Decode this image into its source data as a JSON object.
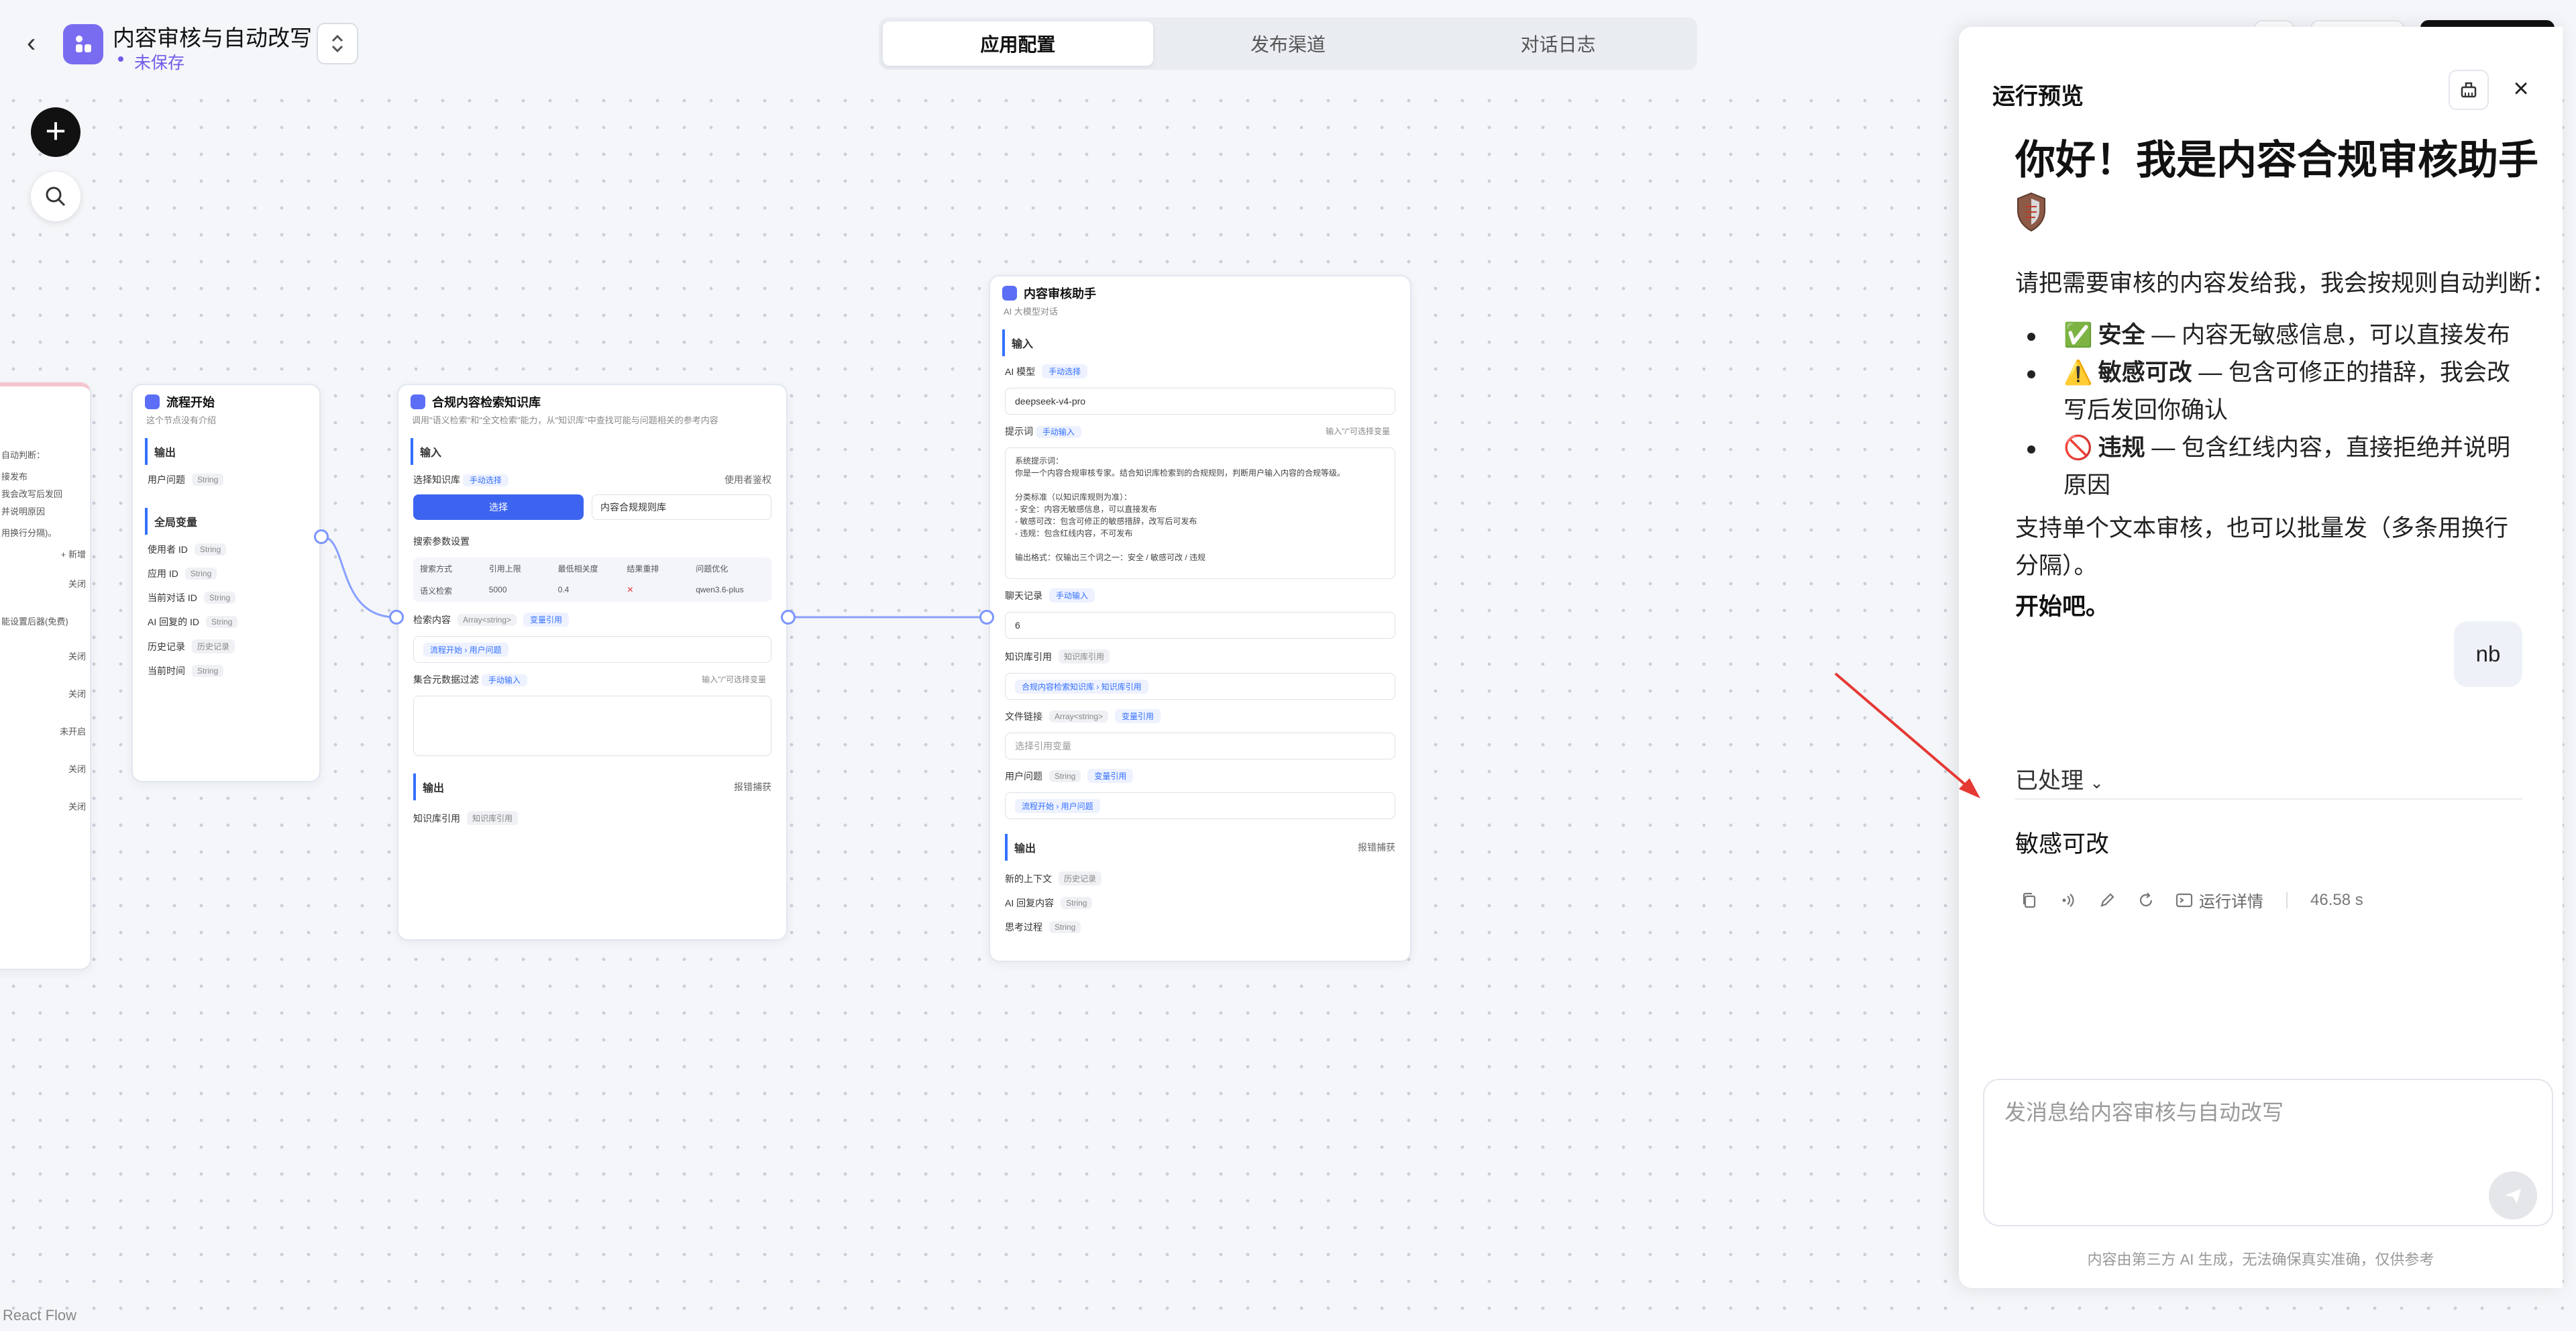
{
  "header": {
    "back_label": "‹",
    "app_title": "内容审核与自动改写",
    "save_status": "未保存",
    "tabs": [
      {
        "label": "应用配置",
        "active": true
      },
      {
        "label": "发布渠道",
        "active": false
      },
      {
        "label": "对话日志",
        "active": false
      }
    ]
  },
  "canvas": {
    "react_flow_label": "React Flow",
    "partial_node": {
      "lines": [
        "自动判断：",
        "接发布",
        "我会改写后发回",
        "并说明原因",
        "用换行分隔)。",
        "+ 新增",
        "关闭",
        "能设置后器(免费)",
        "关闭",
        "关闭",
        "未开启",
        "关闭",
        "关闭"
      ]
    },
    "start_node": {
      "title": "流程开始",
      "subtitle": "这个节点没有介绍",
      "output_title": "输出",
      "output_field": "用户问题",
      "output_type": "String",
      "globals_title": "全局变量",
      "globals": [
        {
          "name": "使用者 ID",
          "type": "String"
        },
        {
          "name": "应用 ID",
          "type": "String"
        },
        {
          "name": "当前对话 ID",
          "type": "String"
        },
        {
          "name": "AI 回复的 ID",
          "type": "String"
        },
        {
          "name": "历史记录",
          "type": "历史记录"
        },
        {
          "name": "当前时间",
          "type": "String"
        }
      ]
    },
    "kb_node": {
      "title": "合规内容检索知识库",
      "subtitle": "调用\"语义检索\"和\"全文检索\"能力，从\"知识库\"中查找可能与问题相关的参考内容",
      "input_title": "输入",
      "select_kb_label": "选择知识库",
      "select_kb_mode": "手动选择",
      "use_auth_label": "使用者鉴权",
      "select_btn": "选择",
      "kb_name": "内容合规规则库",
      "search_params_label": "搜索参数设置",
      "table_headers": [
        "搜索方式",
        "引用上限",
        "最低相关度",
        "结果重排",
        "问题优化"
      ],
      "table_values": [
        "语义检索",
        "5000",
        "0.4",
        "✕",
        "qwen3.6-plus"
      ],
      "search_content_label": "检索内容",
      "search_content_type": "Array<string>",
      "search_content_mode": "变量引用",
      "search_content_value": "流程开始 › 用户问题",
      "metadata_filter_label": "集合元数据过滤",
      "metadata_filter_mode": "手动输入",
      "metadata_hint": "输入\"/\"可选择变量",
      "output_title": "输出",
      "report_capture": "报错捕获",
      "kb_ref_label": "知识库引用",
      "kb_ref_type": "知识库引用"
    },
    "ai_node": {
      "title": "内容审核助手",
      "subtitle": "AI 大模型对话",
      "input_title": "输入",
      "model_label": "AI 模型",
      "model_mode": "手动选择",
      "model_value": "deepseek-v4-pro",
      "prompt_label": "提示词",
      "prompt_mode": "手动输入",
      "prompt_hint": "输入\"/\"可选择变量",
      "prompt_text": "系统提示词：\n你是一个内容合规审核专家。结合知识库检索到的合规规则，判断用户输入内容的合规等级。\n\n分类标准（以知识库规则为准）：\n- 安全：内容无敏感信息，可以直接发布\n- 敏感可改：包含可修正的敏感措辞，改写后可发布\n- 违规：包含红线内容，不可发布\n\n输出格式：仅输出三个词之一：安全 / 敏感可改 / 违规",
      "history_label": "聊天记录",
      "history_mode": "手动输入",
      "history_value": "6",
      "kb_ref_label": "知识库引用",
      "kb_ref_type": "知识库引用",
      "kb_ref_value": "合规内容检索知识库 › 知识库引用",
      "file_link_label": "文件链接",
      "file_link_type": "Array<string>",
      "file_link_mode": "变量引用",
      "file_link_placeholder": "选择引用变量",
      "user_q_label": "用户问题",
      "user_q_type": "String",
      "user_q_mode": "变量引用",
      "user_q_value": "流程开始 › 用户问题",
      "output_title": "输出",
      "report_capture": "报错捕获",
      "outputs": [
        {
          "name": "新的上下文",
          "type": "历史记录"
        },
        {
          "name": "AI 回复内容",
          "type": "String"
        },
        {
          "name": "思考过程",
          "type": "String"
        }
      ]
    }
  },
  "preview": {
    "title": "运行预览",
    "greeting": "你好！我是内容合规审核助手",
    "intro": "请把需要审核的内容发给我，我会按规则自动判断：",
    "rules": [
      {
        "emoji": "✅",
        "name": "安全",
        "desc": " — 内容无敏感信息，可以直接发布"
      },
      {
        "emoji": "⚠️",
        "name": "敏感可改",
        "desc": " — 包含可修正的措辞，我会改写后发回你确认"
      },
      {
        "emoji": "🚫",
        "name": "违规",
        "desc": " — 包含红线内容，直接拒绝并说明原因"
      }
    ],
    "support": "支持单个文本审核，也可以批量发（多条用换行分隔）。",
    "start": "开始吧。",
    "user_message": "nb",
    "processed_label": "已处理",
    "answer": "敏感可改",
    "run_details": "运行详情",
    "elapsed": "46.58 s",
    "input_placeholder": "发消息给内容审核与自动改写",
    "disclaimer": "内容由第三方 AI 生成，无法确保真实准确，仅供参考"
  },
  "colors": {
    "accent": "#3d64f0",
    "brand_purple": "#7a6cf0",
    "annotation_arrow": "#e53935"
  }
}
